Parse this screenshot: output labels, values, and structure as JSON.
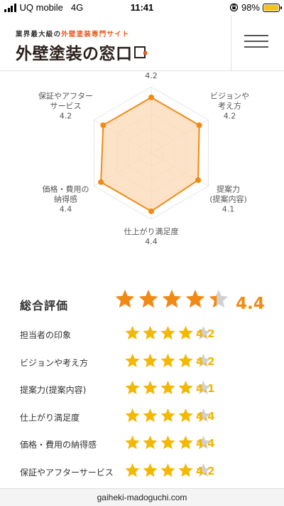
{
  "status_bar": {
    "carrier": "UQ mobile",
    "network": "4G",
    "time": "11:41",
    "battery": "98%",
    "battery_level": 0.98
  },
  "header": {
    "tagline_prefix": "業界最大級の",
    "tagline_accent": "外壁塗装専門サイト",
    "logo_text": "外壁塗装の窓口",
    "menu_icon": "hamburger-menu-icon",
    "accent_color": "#e8581c"
  },
  "radar": {
    "max": 5,
    "levels": 5,
    "fill_color": "#fbd9b4",
    "stroke_color": "#f08a15",
    "axes": [
      {
        "lines": [
          "担当者の印象"
        ],
        "value": 4.2,
        "value_text": "4.2"
      },
      {
        "lines": [
          "ビジョンや",
          "考え方"
        ],
        "value": 4.2,
        "value_text": "4.2"
      },
      {
        "lines": [
          "提案力",
          "(提案内容)"
        ],
        "value": 4.1,
        "value_text": "4.1"
      },
      {
        "lines": [
          "仕上がり満足度"
        ],
        "value": 4.4,
        "value_text": "4.4"
      },
      {
        "lines": [
          "価格・費用の",
          "納得感"
        ],
        "value": 4.4,
        "value_text": "4.4"
      },
      {
        "lines": [
          "保証やアフター",
          "サービス"
        ],
        "value": 4.2,
        "value_text": "4.2"
      }
    ]
  },
  "overall": {
    "label": "総合評価",
    "score": "4.4",
    "rating": 4.4,
    "star_color": "#f08a15"
  },
  "ratings": {
    "star_color": "#f5b800",
    "empty_color": "#d0d0d0",
    "items": [
      {
        "label": "担当者の印象",
        "score": "4.2",
        "rating": 4.2
      },
      {
        "label": "ビジョンや考え方",
        "score": "4.2",
        "rating": 4.2
      },
      {
        "label": "提案力(提案内容)",
        "score": "4.1",
        "rating": 4.1
      },
      {
        "label": "仕上がり満足度",
        "score": "4.4",
        "rating": 4.4
      },
      {
        "label": "価格・費用の納得感",
        "score": "4.4",
        "rating": 4.4
      },
      {
        "label": "保証やアフターサービス",
        "score": "4.2",
        "rating": 4.2
      }
    ]
  },
  "footer": {
    "url": "gaiheki-madoguchi.com"
  }
}
